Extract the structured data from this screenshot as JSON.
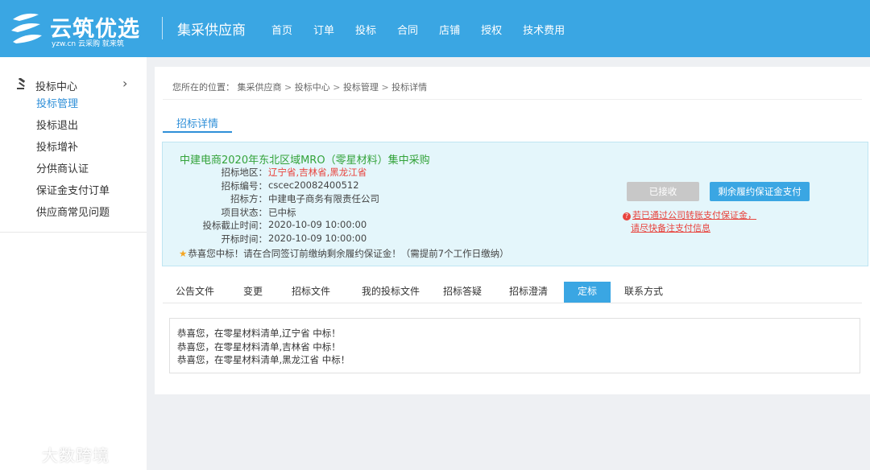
{
  "header": {
    "logo_text": "云筑优选",
    "logo_sub": "yzw.cn 云采购 就来筑",
    "portal_name": "集采供应商",
    "nav": [
      "首页",
      "订单",
      "投标",
      "合同",
      "店铺",
      "授权",
      "技术费用"
    ]
  },
  "sidebar": {
    "title": "投标中心",
    "items": [
      {
        "label": "投标管理",
        "active": true
      },
      {
        "label": "投标退出"
      },
      {
        "label": "投标增补"
      },
      {
        "label": "分供商认证"
      },
      {
        "label": "保证金支付订单"
      },
      {
        "label": "供应商常见问题"
      }
    ],
    "watermark": "大数跨境"
  },
  "breadcrumb": {
    "prefix": "您所在的位置：",
    "items": [
      "集采供应商",
      "投标中心",
      "投标管理",
      "投标详情"
    ]
  },
  "section_tab": "招标详情",
  "tender": {
    "title": "中建电商2020年东北区域MRO（零星材料）集中采购",
    "rows": [
      {
        "key": "招标地区：",
        "value": "辽宁省,吉林省,黑龙江省",
        "red": true
      },
      {
        "key": "招标编号：",
        "value": "cscec20082400512"
      },
      {
        "key": "招标方：",
        "value": "中建电子商务有限责任公司"
      },
      {
        "key": "项目状态：",
        "value": "已中标"
      },
      {
        "key": "投标截止时间：",
        "value": "2020-10-09 10:00:00"
      },
      {
        "key": "开标时间：",
        "value": "2020-10-09 10:00:00"
      }
    ],
    "tip": "恭喜您中标！请在合同签订前缴纳剩余履约保证金！（需提前7个工作日缴纳）",
    "btn_received": "已接收",
    "btn_pay": "剩余履约保证金支付",
    "warning_line1": "若已通过公司转账支付保证金，",
    "warning_line2": "请尽快备注支付信息"
  },
  "tabs": [
    {
      "label": "公告文件"
    },
    {
      "label": "变更"
    },
    {
      "label": "招标文件"
    },
    {
      "label": "我的投标文件"
    },
    {
      "label": "招标答疑"
    },
    {
      "label": "招标澄清"
    },
    {
      "label": "定标",
      "active": true
    },
    {
      "label": "联系方式"
    }
  ],
  "results": [
    "恭喜您，在零星材料清单,辽宁省 中标！",
    "恭喜您，在零星材料清单,吉林省 中标！",
    "恭喜您，在零星材料清单,黑龙江省 中标！"
  ],
  "colors": {
    "brand": "#3aa6e3",
    "active_link": "#2f8fd8",
    "title_green": "#33a33a",
    "alert_red": "#e8433d",
    "info_bg": "#e4f6fb"
  }
}
